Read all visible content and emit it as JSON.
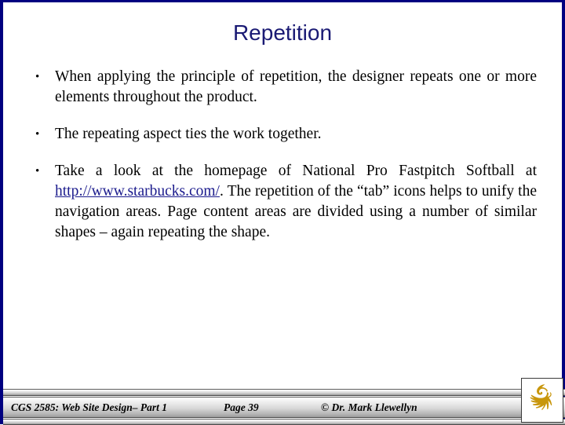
{
  "slide": {
    "title": "Repetition",
    "title_color": "#1a1a74",
    "border_color": "#000080",
    "background": "#ffffff"
  },
  "bullets": [
    {
      "marker": "•",
      "text": "When applying the principle of repetition, the designer repeats one or more elements throughout the product."
    },
    {
      "marker": "•",
      "text": "The repeating aspect ties the work together."
    },
    {
      "marker": "•",
      "text_before_link": "Take a look at the homepage of National Pro Fastpitch Softball at ",
      "link_text": "http://www.starbucks.com/",
      "link_color": "#1a1a8c",
      "text_after_link": ".  The repetition of the “tab” icons helps to unify the navigation areas.  Page content areas are divided using a number of similar shapes – again repeating the shape."
    }
  ],
  "footer": {
    "course": "CGS 2585: Web Site Design– Part 1",
    "page": "Page 39",
    "copyright": "© Dr. Mark Llewellyn"
  },
  "logo": {
    "name": "pegasus-logo",
    "color": "#c8960c"
  }
}
